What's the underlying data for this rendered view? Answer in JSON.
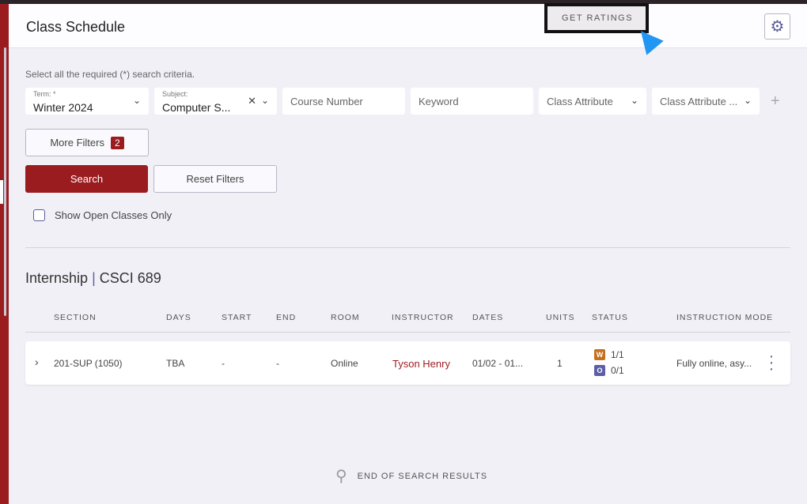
{
  "header": {
    "title": "Class Schedule",
    "get_ratings": "GET RATINGS"
  },
  "filters": {
    "hint": "Select all the required (*) search criteria.",
    "term": {
      "label": "Term: *",
      "value": "Winter 2024"
    },
    "subject": {
      "label": "Subject:",
      "value": "Computer S..."
    },
    "course_number": "Course Number",
    "keyword": "Keyword",
    "class_attribute": "Class Attribute",
    "class_attribute_2": "Class Attribute ...",
    "more_filters": "More Filters",
    "more_filters_count": "2",
    "search": "Search",
    "reset": "Reset Filters",
    "open_only": "Show Open Classes Only"
  },
  "course": {
    "name": "Internship",
    "code": "CSCI 689"
  },
  "columns": [
    "SECTION",
    "DAYS",
    "START",
    "END",
    "ROOM",
    "INSTRUCTOR",
    "DATES",
    "UNITS",
    "STATUS",
    "INSTRUCTION MODE"
  ],
  "row": {
    "section": "201-SUP (1050)",
    "days": "TBA",
    "start": "-",
    "end": "-",
    "room": "Online",
    "instructor": "Tyson Henry",
    "dates": "01/02 - 01...",
    "units": "1",
    "status": [
      {
        "code": "W",
        "value": "1/1",
        "color": "#c4701f"
      },
      {
        "code": "O",
        "value": "0/1",
        "color": "#5b5fa8"
      }
    ],
    "mode": "Fully online, asy..."
  },
  "end_text": "END OF SEARCH RESULTS",
  "colors": {
    "brand": "#9b1c1f",
    "accent": "#5b5b9a"
  }
}
